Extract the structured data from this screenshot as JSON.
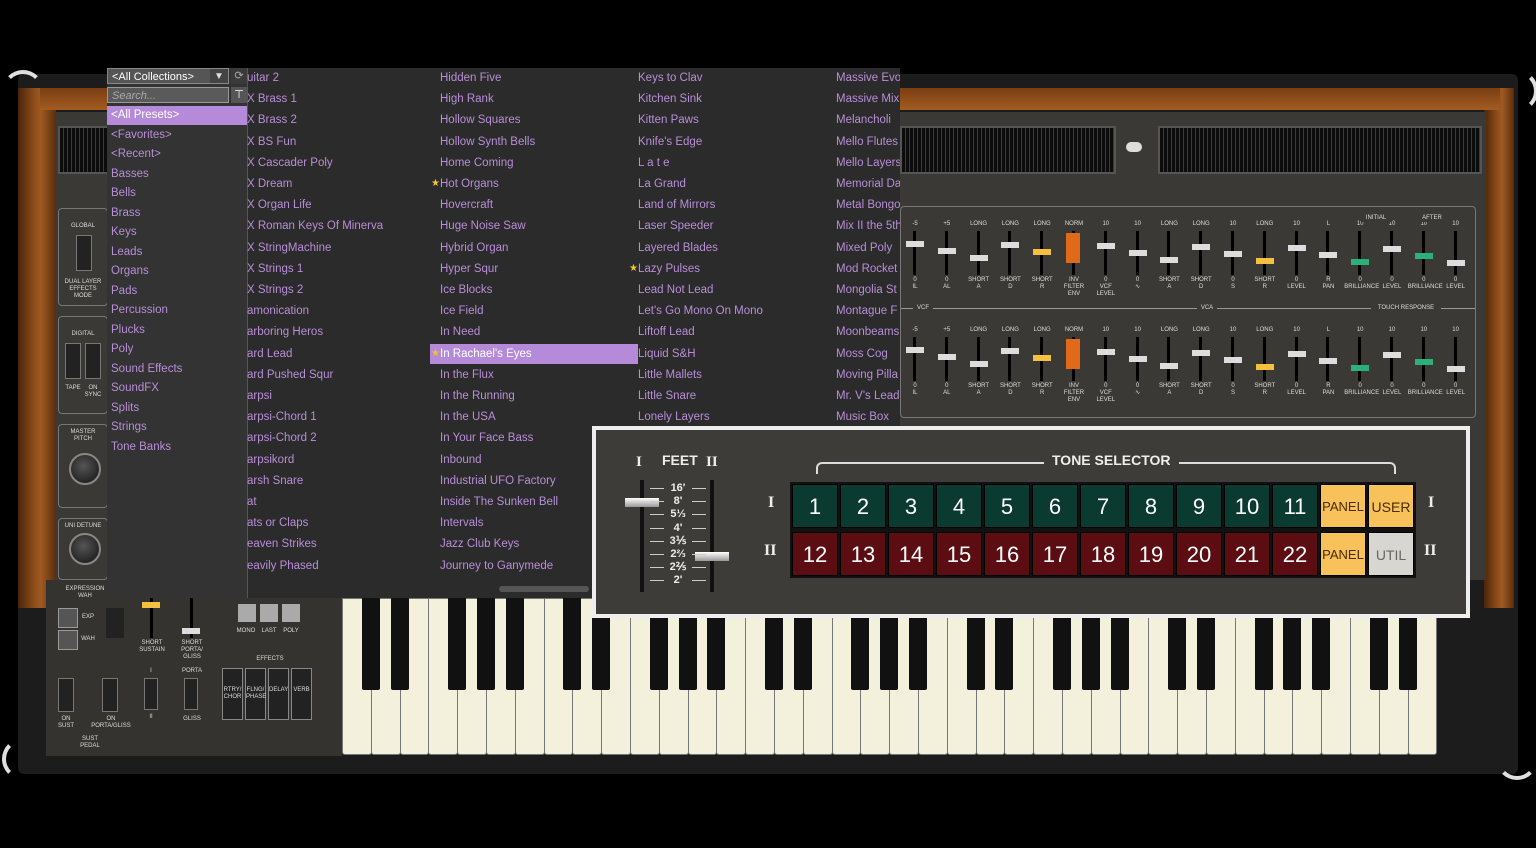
{
  "browser": {
    "collection": "<All Collections>",
    "search_placeholder": "Search...",
    "categories": [
      "<All Presets>",
      "<Favorites>",
      "<Recent>",
      "Basses",
      "Bells",
      "Brass",
      "Keys",
      "Leads",
      "Organs",
      "Pads",
      "Percussion",
      "Plucks",
      "Poly",
      "Sound Effects",
      "SoundFX",
      "Splits",
      "Strings",
      "Tone Banks"
    ],
    "columns": [
      [
        "uitar 2",
        "X Brass 1",
        "X Brass 2",
        "X BS Fun",
        "X Cascader Poly",
        "X Dream",
        "X Organ Life",
        "X Roman Keys Of Minerva",
        "X StringMachine",
        "X Strings 1",
        "X Strings  2",
        "amonication",
        "arboring Heros",
        "ard Lead",
        "ard Pushed Squr",
        "arpsi",
        "arpsi-Chord 1",
        "arpsi-Chord 2",
        "arpsikord",
        "arsh Snare",
        "at",
        "ats or Claps",
        "eaven Strikes",
        "eavily Phased"
      ],
      [
        "Hidden Five",
        "High Rank",
        "Hollow Squares",
        "Hollow Synth Bells",
        "Home Coming",
        "Hot Organs",
        "Hovercraft",
        "Huge Noise Saw",
        "Hybrid Organ",
        "Hyper Squr",
        "Ice Blocks",
        "Ice Field",
        "In Need",
        "In Rachael's Eyes",
        "In the Flux",
        "In the Running",
        "In the USA",
        "In Your Face Bass",
        "Inbound",
        "Industrial UFO Factory",
        "Inside The Sunken Bell",
        "Intervals",
        "Jazz Club Keys",
        "Journey to Ganymede"
      ],
      [
        "Keys to Clav",
        "Kitchen Sink",
        "Kitten Paws",
        "Knife's Edge",
        "L a t e",
        "La Grand",
        "Land of Mirrors",
        "Laser Speeder",
        "Layered Blades",
        "Lazy Pulses",
        "Lead Not Lead",
        "Let's Go Mono On Mono",
        "Liftoff Lead",
        "Liquid S&H",
        "Little Mallets",
        "Little Snare",
        "Lonely Layers"
      ],
      [
        "Massive Evo",
        "Massive Mix",
        "Melancholi",
        "Mello Flutes",
        "Mello Layers",
        "Memorial Da",
        "Metal Bongo",
        "Mix II the 5th",
        "Mixed Poly",
        "Mod Rocket",
        "Mongolia St",
        "Montague F",
        "Moonbeams",
        "Moss Cog",
        "Moving Pilla",
        "Mr. V's Lead",
        "Music Box"
      ]
    ],
    "starred": [
      "Hot Organs",
      "Lazy Pulses",
      "In Rachael's Eyes"
    ],
    "selected": "In Rachael's Eyes"
  },
  "panel": {
    "global": "GLOBAL",
    "dual_layer": "DUAL LAYER\nEFFECTS\nMODE",
    "digital": "DIGITAL",
    "tape": "TAPE",
    "on_sync": "ON\nSYNC",
    "master_pitch": "MASTER\nPITCH",
    "uni_detune": "UNI DETUNE",
    "vcf": "VCF",
    "vca": "VCA",
    "touch_response": "TOUCH RESPONSE",
    "initial": "INITIAL",
    "after": "AFTER",
    "top_row_top": [
      "-5",
      "+5",
      "LONG",
      "LONG",
      "LONG",
      "NORM",
      "10",
      "10",
      "LONG",
      "LONG",
      "10",
      "LONG",
      "10",
      "L",
      "10",
      "10",
      "10",
      "10"
    ],
    "top_row_bottom": [
      "0\nIL",
      "0\nAL",
      "SHORT\nA",
      "SHORT\nD",
      "SHORT\nR",
      "INV\nFILTER\nENV",
      "0\nVCF\nLEVEL",
      "0\n∿",
      "SHORT\nA",
      "SHORT\nD",
      "0\nS",
      "SHORT\nR",
      "0\nLEVEL",
      "R\nPAN",
      "0\nBRILLIANCE",
      "0\nLEVEL",
      "0\nBRILLIANCE",
      "0\nLEVEL"
    ]
  },
  "tone_selector": {
    "feet_label": "FEET",
    "roman_1": "I",
    "roman_2": "II",
    "title": "TONE SELECTOR",
    "feet_values": [
      "16'",
      "8'",
      "5⅓",
      "4'",
      "3⅕",
      "2⅔",
      "2⅖",
      "2'"
    ],
    "row1": [
      "1",
      "2",
      "3",
      "4",
      "5",
      "6",
      "7",
      "8",
      "9",
      "10",
      "11"
    ],
    "row2": [
      "12",
      "13",
      "14",
      "15",
      "16",
      "17",
      "18",
      "19",
      "20",
      "21",
      "22"
    ],
    "panel_label": "PANEL",
    "user_label": "USER",
    "util_label": "UTIL"
  },
  "bottom_left": {
    "expression_wah": "EXPRESSION\nWAH",
    "exp": "EXP",
    "wah": "WAH",
    "short_sustain": "SHORT\nSUSTAIN",
    "short_porta": "SHORT\nPORTA/\nGLISS",
    "mode": "MODE",
    "mono": "MONO",
    "last": "LAST",
    "poly": "POLY",
    "i": "I",
    "ii": "II",
    "porta": "PORTA",
    "gliss": "GLISS",
    "effects": "EFFECTS",
    "effect_buttons": [
      "RTRY/\nCHOR",
      "FLNG/\nPHASE",
      "DELAY",
      "VERB"
    ],
    "on_sust": "ON\nSUST",
    "on_porta": "ON\nPORTA/GLISS",
    "sust_pedal": "SUST\nPEDAL"
  }
}
